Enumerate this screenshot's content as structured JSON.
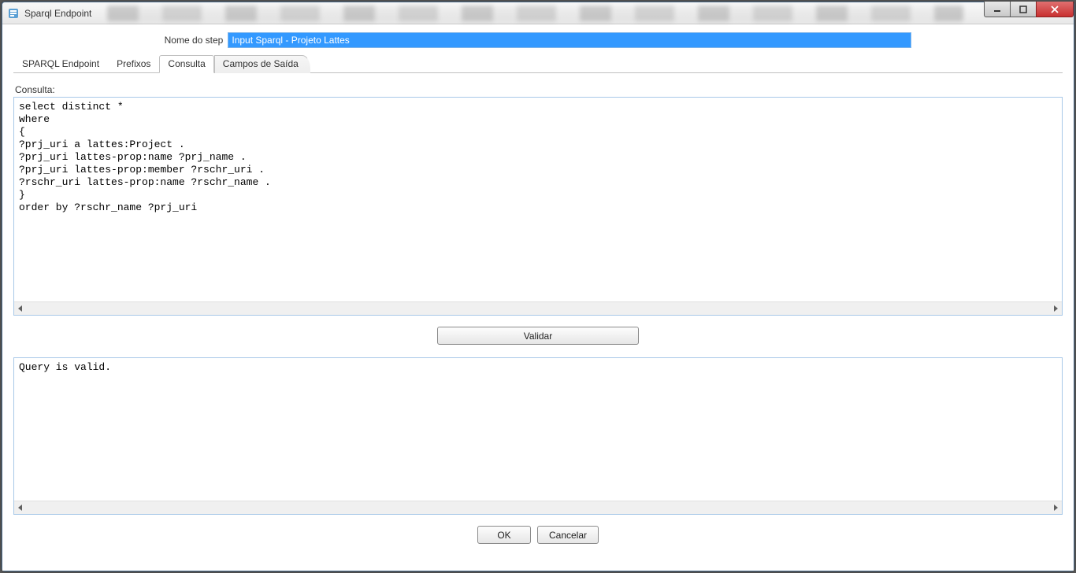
{
  "window": {
    "title": "Sparql Endpoint"
  },
  "step": {
    "label": "Nome do step",
    "value": "Input Sparql - Projeto Lattes"
  },
  "tabs": [
    {
      "label": "SPARQL Endpoint",
      "active": false
    },
    {
      "label": "Prefixos",
      "active": false
    },
    {
      "label": "Consulta",
      "active": true
    },
    {
      "label": "Campos de Saída",
      "active": false
    }
  ],
  "query": {
    "label": "Consulta:",
    "text": "select distinct *\nwhere\n{\n?prj_uri a lattes:Project .\n?prj_uri lattes-prop:name ?prj_name .\n?prj_uri lattes-prop:member ?rschr_uri .\n?rschr_uri lattes-prop:name ?rschr_name .\n}\norder by ?rschr_name ?prj_uri"
  },
  "buttons": {
    "validate": "Validar",
    "ok": "OK",
    "cancel": "Cancelar"
  },
  "result": {
    "text": "Query is valid."
  }
}
